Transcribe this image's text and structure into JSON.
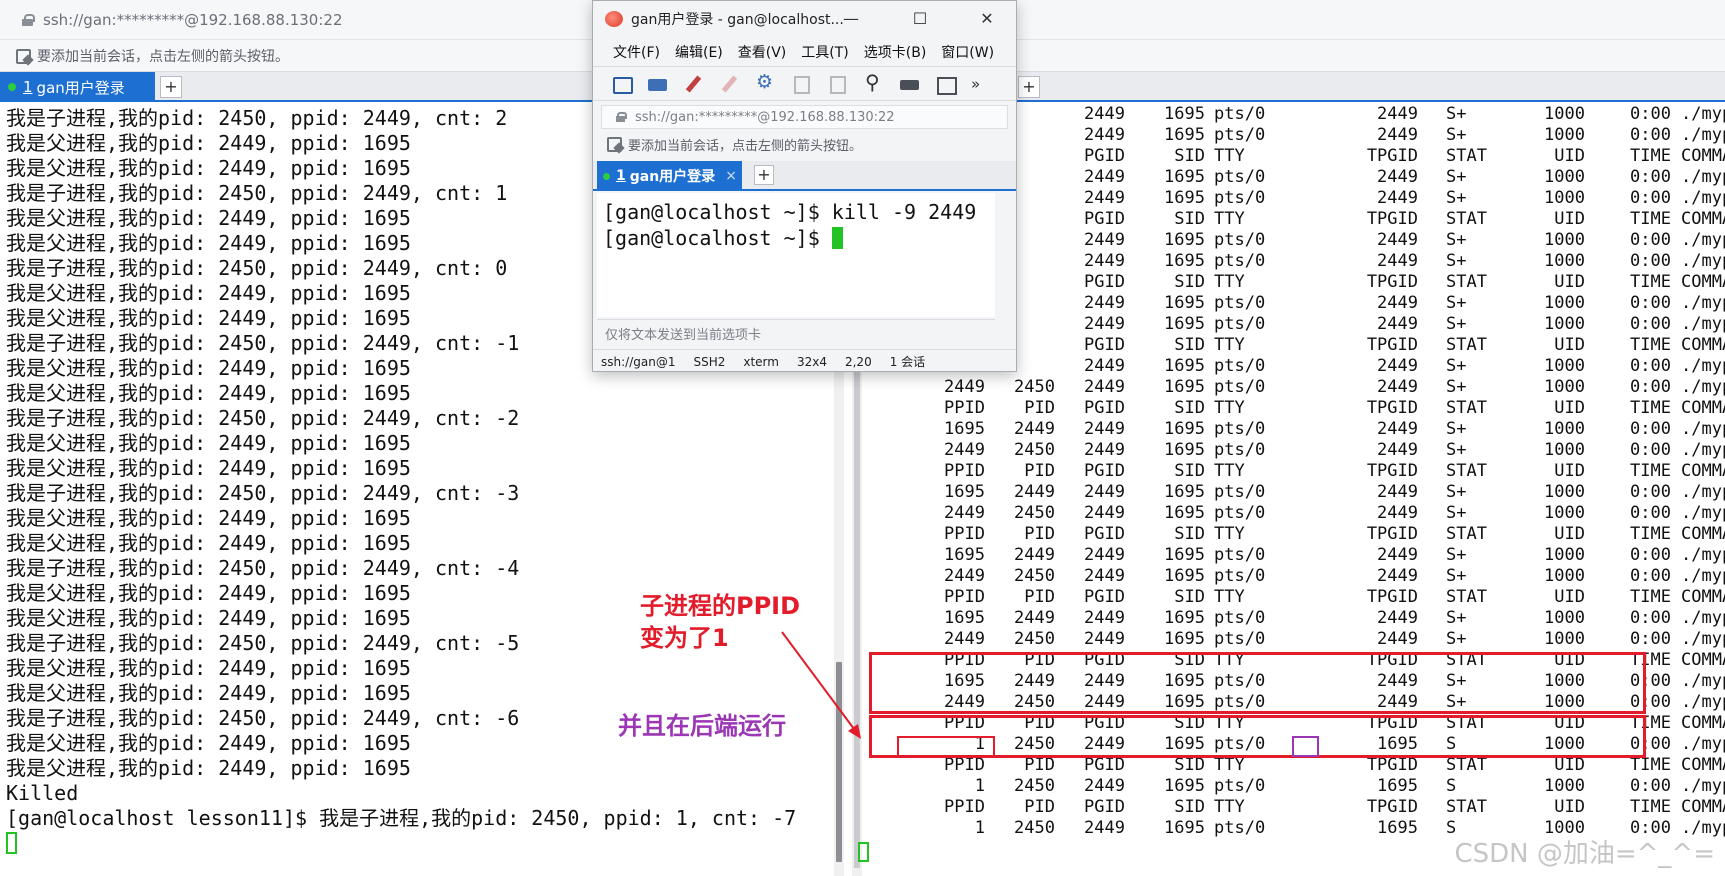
{
  "left_window": {
    "address": "ssh://gan:*********@192.168.88.130:22",
    "hint": "要添加当前会话，点击左侧的箭头按钮。",
    "tab": {
      "number": "1",
      "label": "gan用户登录"
    },
    "plus": "+",
    "lines": [
      "我是子进程,我的pid: 2450, ppid: 2449, cnt: 2",
      "我是父进程,我的pid: 2449, ppid: 1695",
      "我是父进程,我的pid: 2449, ppid: 1695",
      "我是子进程,我的pid: 2450, ppid: 2449, cnt: 1",
      "我是父进程,我的pid: 2449, ppid: 1695",
      "我是父进程,我的pid: 2449, ppid: 1695",
      "我是子进程,我的pid: 2450, ppid: 2449, cnt: 0",
      "我是父进程,我的pid: 2449, ppid: 1695",
      "我是父进程,我的pid: 2449, ppid: 1695",
      "我是子进程,我的pid: 2450, ppid: 2449, cnt: -1",
      "我是父进程,我的pid: 2449, ppid: 1695",
      "我是父进程,我的pid: 2449, ppid: 1695",
      "我是子进程,我的pid: 2450, ppid: 2449, cnt: -2",
      "我是父进程,我的pid: 2449, ppid: 1695",
      "我是父进程,我的pid: 2449, ppid: 1695",
      "我是子进程,我的pid: 2450, ppid: 2449, cnt: -3",
      "我是父进程,我的pid: 2449, ppid: 1695",
      "我是父进程,我的pid: 2449, ppid: 1695",
      "我是子进程,我的pid: 2450, ppid: 2449, cnt: -4",
      "我是父进程,我的pid: 2449, ppid: 1695",
      "我是父进程,我的pid: 2449, ppid: 1695",
      "我是子进程,我的pid: 2450, ppid: 2449, cnt: -5",
      "我是父进程,我的pid: 2449, ppid: 1695",
      "我是父进程,我的pid: 2449, ppid: 1695",
      "我是子进程,我的pid: 2450, ppid: 2449, cnt: -6",
      "我是父进程,我的pid: 2449, ppid: 1695",
      "我是父进程,我的pid: 2449, ppid: 1695",
      "Killed",
      "[gan@localhost lesson11]$ 我是子进程,我的pid: 2450, ppid: 1, cnt: -7"
    ]
  },
  "right_window": {
    "plus": "+",
    "rows": [
      [
        "",
        "",
        "2449",
        "1695",
        "pts/0",
        "2449",
        "S+",
        "1000",
        "0:00",
        "./myprocess"
      ],
      [
        "",
        "",
        "2449",
        "1695",
        "pts/0",
        "2449",
        "S+",
        "1000",
        "0:00",
        "./myprocess"
      ],
      [
        "",
        "",
        "PGID",
        "SID",
        "TTY",
        "TPGID",
        "STAT",
        "UID",
        "TIME",
        "COMMAND"
      ],
      [
        "",
        "",
        "2449",
        "1695",
        "pts/0",
        "2449",
        "S+",
        "1000",
        "0:00",
        "./myprocess"
      ],
      [
        "",
        "",
        "2449",
        "1695",
        "pts/0",
        "2449",
        "S+",
        "1000",
        "0:00",
        "./myprocess"
      ],
      [
        "",
        "",
        "PGID",
        "SID",
        "TTY",
        "TPGID",
        "STAT",
        "UID",
        "TIME",
        "COMMAND"
      ],
      [
        "",
        "",
        "2449",
        "1695",
        "pts/0",
        "2449",
        "S+",
        "1000",
        "0:00",
        "./myprocess"
      ],
      [
        "",
        "",
        "2449",
        "1695",
        "pts/0",
        "2449",
        "S+",
        "1000",
        "0:00",
        "./myprocess"
      ],
      [
        "",
        "",
        "PGID",
        "SID",
        "TTY",
        "TPGID",
        "STAT",
        "UID",
        "TIME",
        "COMMAND"
      ],
      [
        "",
        "",
        "2449",
        "1695",
        "pts/0",
        "2449",
        "S+",
        "1000",
        "0:00",
        "./myprocess"
      ],
      [
        "",
        "",
        "2449",
        "1695",
        "pts/0",
        "2449",
        "S+",
        "1000",
        "0:00",
        "./myprocess"
      ],
      [
        "",
        "",
        "PGID",
        "SID",
        "TTY",
        "TPGID",
        "STAT",
        "UID",
        "TIME",
        "COMMAND"
      ],
      [
        "",
        "",
        "2449",
        "1695",
        "pts/0",
        "2449",
        "S+",
        "1000",
        "0:00",
        "./myprocess"
      ],
      [
        "2449",
        "2450",
        "2449",
        "1695",
        "pts/0",
        "2449",
        "S+",
        "1000",
        "0:00",
        "./myprocess"
      ],
      [
        "PPID",
        "PID",
        "PGID",
        "SID",
        "TTY",
        "TPGID",
        "STAT",
        "UID",
        "TIME",
        "COMMAND"
      ],
      [
        "1695",
        "2449",
        "2449",
        "1695",
        "pts/0",
        "2449",
        "S+",
        "1000",
        "0:00",
        "./myprocess"
      ],
      [
        "2449",
        "2450",
        "2449",
        "1695",
        "pts/0",
        "2449",
        "S+",
        "1000",
        "0:00",
        "./myprocess"
      ],
      [
        "PPID",
        "PID",
        "PGID",
        "SID",
        "TTY",
        "TPGID",
        "STAT",
        "UID",
        "TIME",
        "COMMAND"
      ],
      [
        "1695",
        "2449",
        "2449",
        "1695",
        "pts/0",
        "2449",
        "S+",
        "1000",
        "0:00",
        "./myprocess"
      ],
      [
        "2449",
        "2450",
        "2449",
        "1695",
        "pts/0",
        "2449",
        "S+",
        "1000",
        "0:00",
        "./myprocess"
      ],
      [
        "PPID",
        "PID",
        "PGID",
        "SID",
        "TTY",
        "TPGID",
        "STAT",
        "UID",
        "TIME",
        "COMMAND"
      ],
      [
        "1695",
        "2449",
        "2449",
        "1695",
        "pts/0",
        "2449",
        "S+",
        "1000",
        "0:00",
        "./myprocess"
      ],
      [
        "2449",
        "2450",
        "2449",
        "1695",
        "pts/0",
        "2449",
        "S+",
        "1000",
        "0:00",
        "./myprocess"
      ],
      [
        "PPID",
        "PID",
        "PGID",
        "SID",
        "TTY",
        "TPGID",
        "STAT",
        "UID",
        "TIME",
        "COMMAND"
      ],
      [
        "1695",
        "2449",
        "2449",
        "1695",
        "pts/0",
        "2449",
        "S+",
        "1000",
        "0:00",
        "./myprocess"
      ],
      [
        "2449",
        "2450",
        "2449",
        "1695",
        "pts/0",
        "2449",
        "S+",
        "1000",
        "0:00",
        "./myprocess"
      ],
      [
        "PPID",
        "PID",
        "PGID",
        "SID",
        "TTY",
        "TPGID",
        "STAT",
        "UID",
        "TIME",
        "COMMAND"
      ],
      [
        "1695",
        "2449",
        "2449",
        "1695",
        "pts/0",
        "2449",
        "S+",
        "1000",
        "0:00",
        "./myprocess"
      ],
      [
        "2449",
        "2450",
        "2449",
        "1695",
        "pts/0",
        "2449",
        "S+",
        "1000",
        "0:00",
        "./myprocess"
      ],
      [
        "PPID",
        "PID",
        "PGID",
        "SID",
        "TTY",
        "TPGID",
        "STAT",
        "UID",
        "TIME",
        "COMMAND"
      ],
      [
        "1",
        "2450",
        "2449",
        "1695",
        "pts/0",
        "1695",
        "S",
        "1000",
        "0:00",
        "./myprocess"
      ],
      [
        "PPID",
        "PID",
        "PGID",
        "SID",
        "TTY",
        "TPGID",
        "STAT",
        "UID",
        "TIME",
        "COMMAND"
      ],
      [
        "1",
        "2450",
        "2449",
        "1695",
        "pts/0",
        "1695",
        "S",
        "1000",
        "0:00",
        "./myprocess"
      ],
      [
        "PPID",
        "PID",
        "PGID",
        "SID",
        "TTY",
        "TPGID",
        "STAT",
        "UID",
        "TIME",
        "COMMAND"
      ],
      [
        "1",
        "2450",
        "2449",
        "1695",
        "pts/0",
        "1695",
        "S",
        "1000",
        "0:00",
        "./myprocess"
      ]
    ]
  },
  "xshell": {
    "title": "gan用户登录 - gan@localhost...",
    "window_buttons": {
      "minimize": "—",
      "maximize": "☐",
      "close": "✕"
    },
    "menu": [
      "文件(F)",
      "编辑(E)",
      "查看(V)",
      "工具(T)",
      "选项卡(B)",
      "窗口(W)"
    ],
    "more": "»",
    "address": "ssh://gan:*********@192.168.88.130:22",
    "hint": "要添加当前会话，点击左侧的箭头按钮。",
    "tab": {
      "number": "1",
      "label": "gan用户登录",
      "close": "×"
    },
    "plus": "+",
    "terminal": [
      "[gan@localhost ~]$ kill -9 2449",
      "[gan@localhost ~]$ "
    ],
    "send_placeholder": "仅将文本发送到当前选项卡",
    "status": [
      "ssh://gan@1",
      "SSH2",
      "xterm",
      "32x4",
      "2,20",
      "1 会话"
    ]
  },
  "annotations": {
    "red": "子进程的PPID\n变为了1",
    "purple": "并且在后端运行",
    "colors": {
      "red": "#e21c2a",
      "purple": "#9b37b5",
      "cursor": "#22c322",
      "tab": "#1d6fd1"
    }
  },
  "watermark": "CSDN @加油=^_^="
}
